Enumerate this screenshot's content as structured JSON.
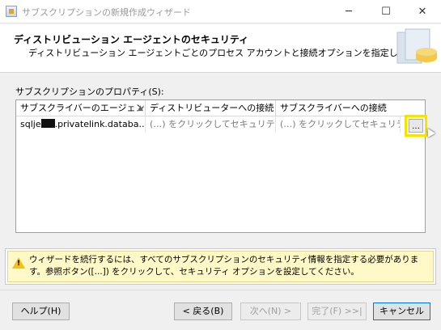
{
  "window": {
    "title": "サブスクリプションの新規作成ウィザード",
    "controls": {
      "minimize": "─",
      "maximize": "☐",
      "close": "✕"
    }
  },
  "header": {
    "title": "ディストリビューション エージェントのセキュリティ",
    "subtitle": "ディストリビューション エージェントごとのプロセス アカウントと接続オプションを指定します。"
  },
  "properties": {
    "label": "サブスクリプションのプロパティ(S):",
    "columns": [
      "サブスクライバーのエージェント",
      "ディストリビューターへの接続",
      "サブスクライバーへの接続"
    ],
    "rows": [
      {
        "agent_prefix": "sqlje",
        "agent_suffix": ".privatelink.databa…",
        "distributor_connection": "(…) をクリックしてセキュリティ…",
        "subscriber_connection": "(…) をクリックしてセキュリティ…",
        "browse_label": "…"
      }
    ]
  },
  "warning": {
    "icon": "warning-icon",
    "text": "ウィザードを続行するには、すべてのサブスクリプションのセキュリティ情報を指定する必要があります。参照ボタン([...]) をクリックして、セキュリティ オプションを設定してください。"
  },
  "buttons": {
    "help": "ヘルプ(H)",
    "back": "< 戻る(B)",
    "next": "次へ(N) >",
    "finish": "完了(F) >>|",
    "cancel": "キャンセル"
  },
  "colors": {
    "highlight": "#f3e500",
    "warning_bg": "#fff8c7",
    "accent": "#0078d7"
  }
}
